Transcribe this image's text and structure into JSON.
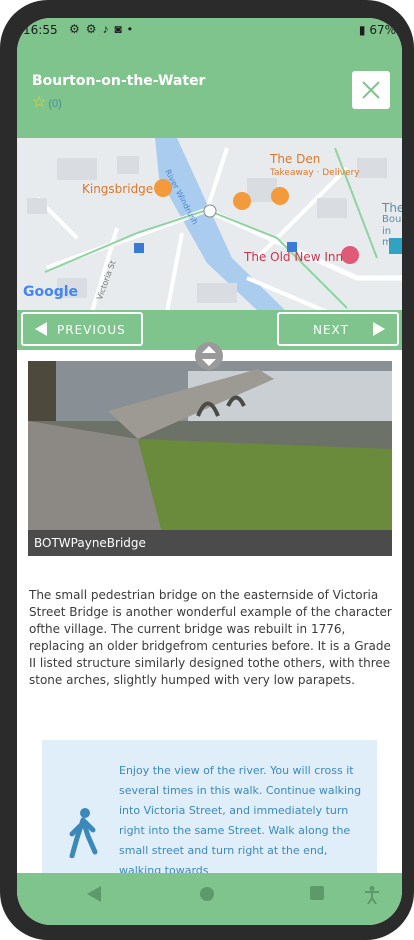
{
  "status": {
    "time": "16:55",
    "icons": [
      "gear-icon",
      "gear-icon",
      "music-icon",
      "sd-card-icon",
      "dot-icon"
    ],
    "battery": "67%"
  },
  "header": {
    "title": "Bourton-on-the-Water",
    "rating_star": "☆",
    "rating_count": "(0)",
    "close_icon": "close-icon"
  },
  "map": {
    "places": {
      "kingsbridge": "Kingsbridge",
      "the_den": "The Den",
      "the_den_sub": "Takeaway · Delivery",
      "old_new_inn": "The Old New Inn",
      "river": "River Windrush",
      "victoria_st": "Victoria St",
      "partial_right": "The",
      "partial_right2": "Bour",
      "partial_right3": "in m"
    },
    "logo": "Google"
  },
  "nav": {
    "previous": "PREVIOUS",
    "next": "NEXT"
  },
  "image": {
    "caption": "BOTWPayneBridge"
  },
  "description": "The small pedestrian bridge on the easternside of Victoria Street Bridge is another wonderful example of the character ofthe village. The current bridge was rebuilt in 1776, replacing an older bridgefrom centuries before. It is a Grade II listed structure similarly designed tothe others, with three stone arches, slightly humped with very low parapets.",
  "directions": {
    "icon": "walking-person-icon",
    "text": "Enjoy the view of the river. You will cross it several times in this walk. Continue walking into Victoria Street, and immediately turn right into the same Street. Walk along the small street and turn right at the end, walking towards"
  },
  "colors": {
    "header": "#7fc38d",
    "callout": "#dfeef9",
    "callout_text": "#3c89b9"
  }
}
